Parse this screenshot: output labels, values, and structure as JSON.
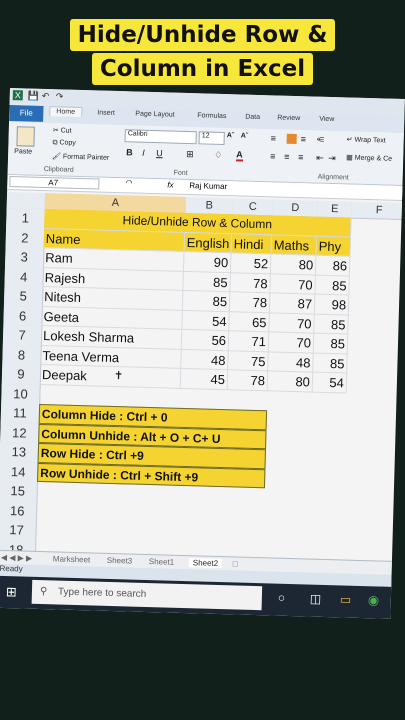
{
  "overlay_title": {
    "line1": "Hide/Unhide Row &",
    "line2": "Column in Excel"
  },
  "ribbon": {
    "tabs": [
      "File",
      "Home",
      "Insert",
      "Page Layout",
      "Formulas",
      "Data",
      "Review",
      "View"
    ],
    "clipboard": {
      "paste": "Paste",
      "cut": "Cut",
      "copy": "Copy",
      "format_painter": "Format Painter",
      "group": "Clipboard"
    },
    "font": {
      "name": "Calibri",
      "size": "12",
      "group": "Font"
    },
    "alignment": {
      "wrap_text": "Wrap Text",
      "merge": "Merge & Ce",
      "group": "Alignment"
    }
  },
  "formula_bar": {
    "name_box": "A7",
    "fx": "fx",
    "content": "Raj Kumar"
  },
  "columns": [
    "A",
    "B",
    "C",
    "D",
    "E",
    "F"
  ],
  "row_numbers": [
    "1",
    "2",
    "3",
    "4",
    "5",
    "6",
    "7",
    "8",
    "9",
    "10",
    "11",
    "12",
    "13",
    "14",
    "15",
    "16",
    "17",
    "18"
  ],
  "table": {
    "title": "Hide/Unhide Row & Column",
    "headers": [
      "Name",
      "English",
      "Hindi",
      "Maths",
      "Phy"
    ],
    "rows": [
      [
        "Ram",
        "90",
        "52",
        "80",
        "86"
      ],
      [
        "Rajesh",
        "85",
        "78",
        "70",
        "85"
      ],
      [
        "Nitesh",
        "85",
        "78",
        "87",
        "98"
      ],
      [
        "Geeta",
        "54",
        "65",
        "70",
        "85"
      ],
      [
        "Lokesh Sharma",
        "56",
        "71",
        "70",
        "85"
      ],
      [
        "Teena Verma",
        "48",
        "75",
        "48",
        "85"
      ],
      [
        "Deepak",
        "45",
        "78",
        "80",
        "54"
      ]
    ]
  },
  "shortcuts": [
    "Column Hide : Ctrl + 0",
    "Column Unhide : Alt + O + C+ U",
    "Row Hide : Ctrl +9",
    "Row Unhide : Ctrl + Shift +9"
  ],
  "sheet_tabs": [
    "Marksheet",
    "Sheet3",
    "Sheet1",
    "Sheet2"
  ],
  "status": "Ready",
  "taskbar": {
    "search_placeholder": "Type here to search"
  }
}
